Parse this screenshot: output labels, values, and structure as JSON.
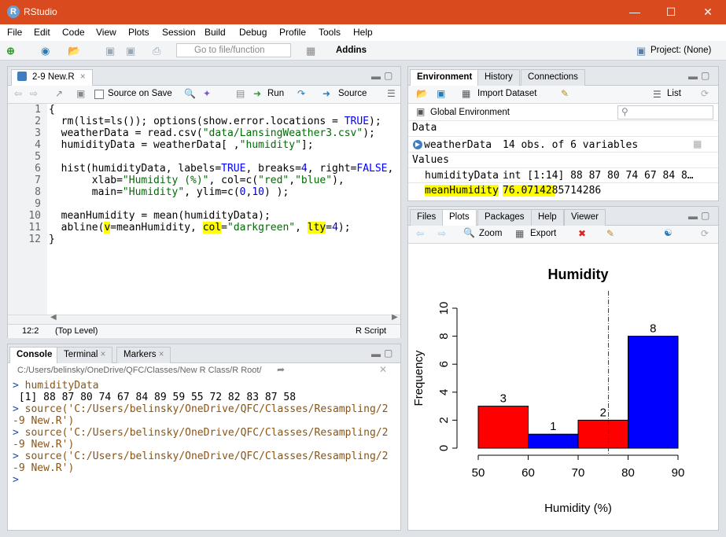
{
  "window": {
    "title": "RStudio",
    "logo": "R",
    "min_icon": "minimize-icon",
    "max_icon": "maximize-icon",
    "close_icon": "close-icon"
  },
  "menu": [
    "File",
    "Edit",
    "Code",
    "View",
    "Plots",
    "Session",
    "Build",
    "Debug",
    "Profile",
    "Tools",
    "Help"
  ],
  "toolbar": {
    "goto_placeholder": "Go to file/function",
    "addins": "Addins",
    "project": "Project: (None)"
  },
  "editor": {
    "tab_label": "2-9 New.R",
    "source_on_save": "Source on Save",
    "run": "Run",
    "source": "Source",
    "lines": [
      "{",
      "  rm(list=ls()); options(show.error.locations = TRUE);",
      "  weatherData = read.csv(\"data/LansingWeather3.csv\");",
      "  humidityData = weatherData[ ,\"humidity\"];",
      "",
      "  hist(humidityData, labels=TRUE, breaks=4, right=FALSE,",
      "       xlab=\"Humidity (%)\", col=c(\"red\",\"blue\"),",
      "       main=\"Humidity\", ylim=c(0,10) );",
      "",
      "  meanHumidity = mean(humidityData);",
      "  abline(v=meanHumidity, col=\"darkgreen\", lty=4);",
      "}"
    ],
    "status_pos": "12:2",
    "status_scope": "(Top Level)",
    "status_type": "R Script"
  },
  "console": {
    "tabs": [
      "Console",
      "Terminal",
      "Markers"
    ],
    "path": "C:/Users/belinsky/OneDrive/QFC/Classes/New R Class/R Root/",
    "lines": [
      {
        "p": "> ",
        "t": "humidityData",
        "c": "cmd"
      },
      {
        "p": "",
        "t": " [1] 88 87 80 74 67 84 89 59 55 72 82 83 87 58",
        "c": "out"
      },
      {
        "p": "> ",
        "t": "source('C:/Users/belinsky/OneDrive/QFC/Classes/Resampling/2",
        "c": "cmd"
      },
      {
        "p": "",
        "t": "-9 New.R')",
        "c": "cmd"
      },
      {
        "p": "> ",
        "t": "source('C:/Users/belinsky/OneDrive/QFC/Classes/Resampling/2",
        "c": "cmd"
      },
      {
        "p": "",
        "t": "-9 New.R')",
        "c": "cmd"
      },
      {
        "p": "> ",
        "t": "source('C:/Users/belinsky/OneDrive/QFC/Classes/Resampling/2",
        "c": "cmd"
      },
      {
        "p": "",
        "t": "-9 New.R')",
        "c": "cmd"
      },
      {
        "p": "> ",
        "t": "",
        "c": "cmd"
      }
    ]
  },
  "environment": {
    "tabs": [
      "Environment",
      "History",
      "Connections"
    ],
    "import": "Import Dataset",
    "list_mode": "List",
    "scope": "Global Environment",
    "data_header": "Data",
    "data_rows": [
      {
        "name": "weatherData",
        "value": "14 obs. of 6 variables"
      }
    ],
    "values_header": "Values",
    "value_rows": [
      {
        "name": "humidityData",
        "value": "int [1:14] 88 87 80 74 67 84 8…"
      },
      {
        "name": "meanHumidity",
        "value": "76.0714285714286"
      }
    ]
  },
  "files": {
    "tabs": [
      "Files",
      "Plots",
      "Packages",
      "Help",
      "Viewer"
    ],
    "zoom": "Zoom",
    "export": "Export"
  },
  "chart_data": {
    "type": "bar",
    "title": "Humidity",
    "xlabel": "Humidity (%)",
    "ylabel": "Frequency",
    "bins": [
      [
        50,
        60
      ],
      [
        60,
        70
      ],
      [
        70,
        80
      ],
      [
        80,
        90
      ]
    ],
    "values": [
      3,
      1,
      2,
      8
    ],
    "labels": [
      "3",
      "1",
      "2",
      "8"
    ],
    "colors": [
      "#ff0000",
      "#0000ff",
      "#ff0000",
      "#0000ff"
    ],
    "xticks": [
      "50",
      "60",
      "70",
      "80",
      "90"
    ],
    "yticks": [
      "0",
      "2",
      "4",
      "6",
      "8",
      "10"
    ],
    "xlim": [
      50,
      90
    ],
    "ylim": [
      0,
      10
    ],
    "abline_v": 76.0714285714286,
    "abline_color": "#006400"
  }
}
